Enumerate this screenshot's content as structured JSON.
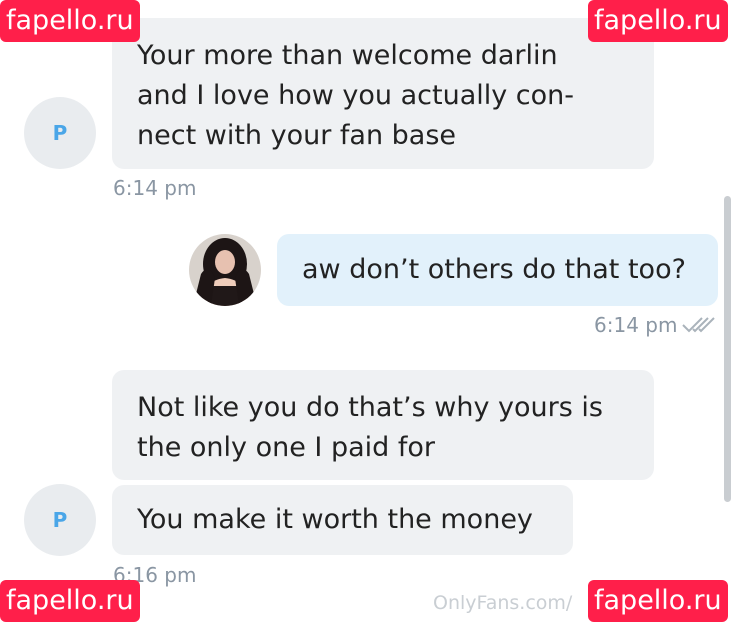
{
  "watermarks": {
    "top_left": "fapello.ru",
    "top_right": "fapello.ru",
    "bottom_left": "fapello.ru",
    "bottom_right": "fapello.ru",
    "onlyfans": "OnlyFans.com/"
  },
  "avatar_letter": "P",
  "messages": [
    {
      "sender": "P",
      "lines": [
        "Your more than welcome darlin",
        "and I love how you actually con-",
        "nect with your fan base"
      ],
      "time": "6:14 pm"
    },
    {
      "sender": "me",
      "text": "aw don’t others do that too?",
      "time": "6:14 pm",
      "status": "double-check-icon"
    },
    {
      "sender": "P",
      "lines": [
        "Not like you do that’s why yours is",
        "the only one I paid for"
      ]
    },
    {
      "sender": "P",
      "text": "You make it worth the money",
      "time": "6:16 pm"
    }
  ],
  "colors": {
    "incoming_bubble": "#eff1f3",
    "outgoing_bubble": "#e2f1fb",
    "time_text": "#8a96a3",
    "avatar_letter": "#4aa6e8",
    "watermark": "#ff1f4a"
  }
}
